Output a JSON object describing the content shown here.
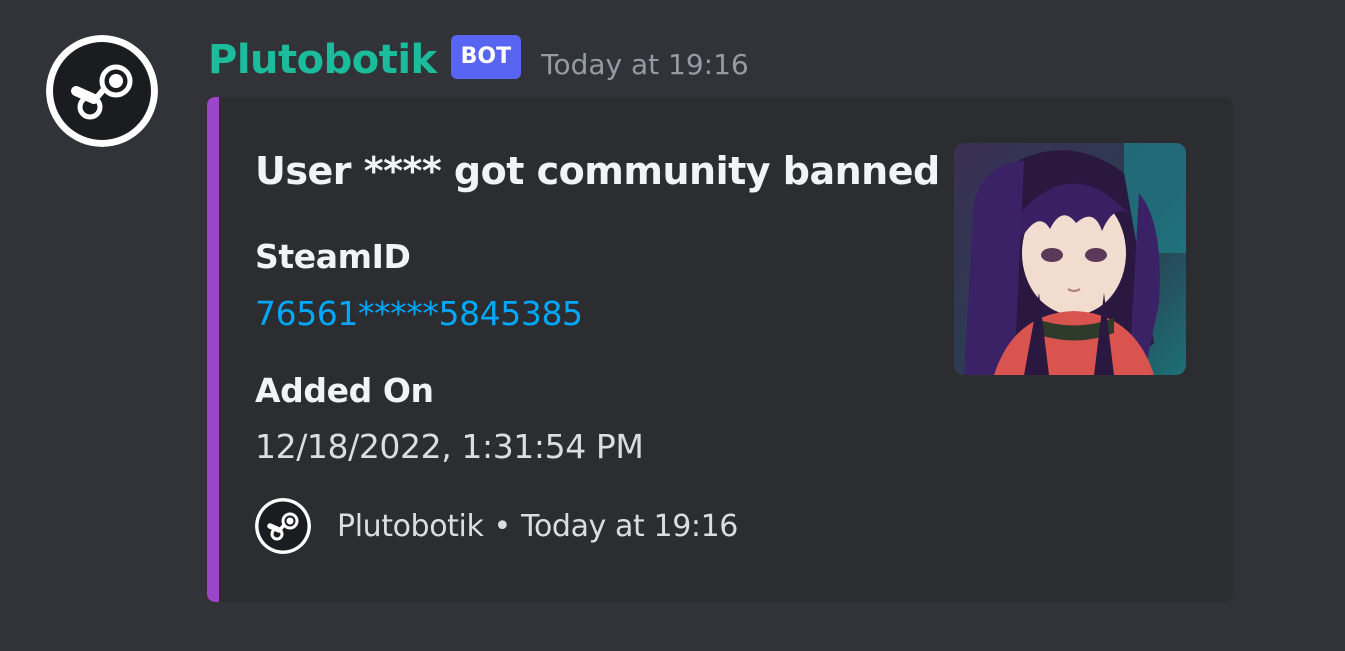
{
  "message": {
    "author": "Plutobotik",
    "bot_tag": "BOT",
    "timestamp": "Today at 19:16",
    "author_color": "#1abc9c"
  },
  "embed": {
    "accent_color": "#9b45c9",
    "title": "User **** got community banned",
    "fields": [
      {
        "name": "SteamID",
        "value": "76561*****5845385"
      },
      {
        "name": "Added On",
        "value": "12/18/2022, 1:31:54 PM"
      }
    ],
    "thumbnail_icon": "anime-avatar-thumbnail",
    "footer": {
      "icon": "steam-icon",
      "text": "Plutobotik",
      "separator": "•",
      "timestamp": "Today at 19:16"
    }
  },
  "icons": {
    "avatar": "steam-icon"
  }
}
